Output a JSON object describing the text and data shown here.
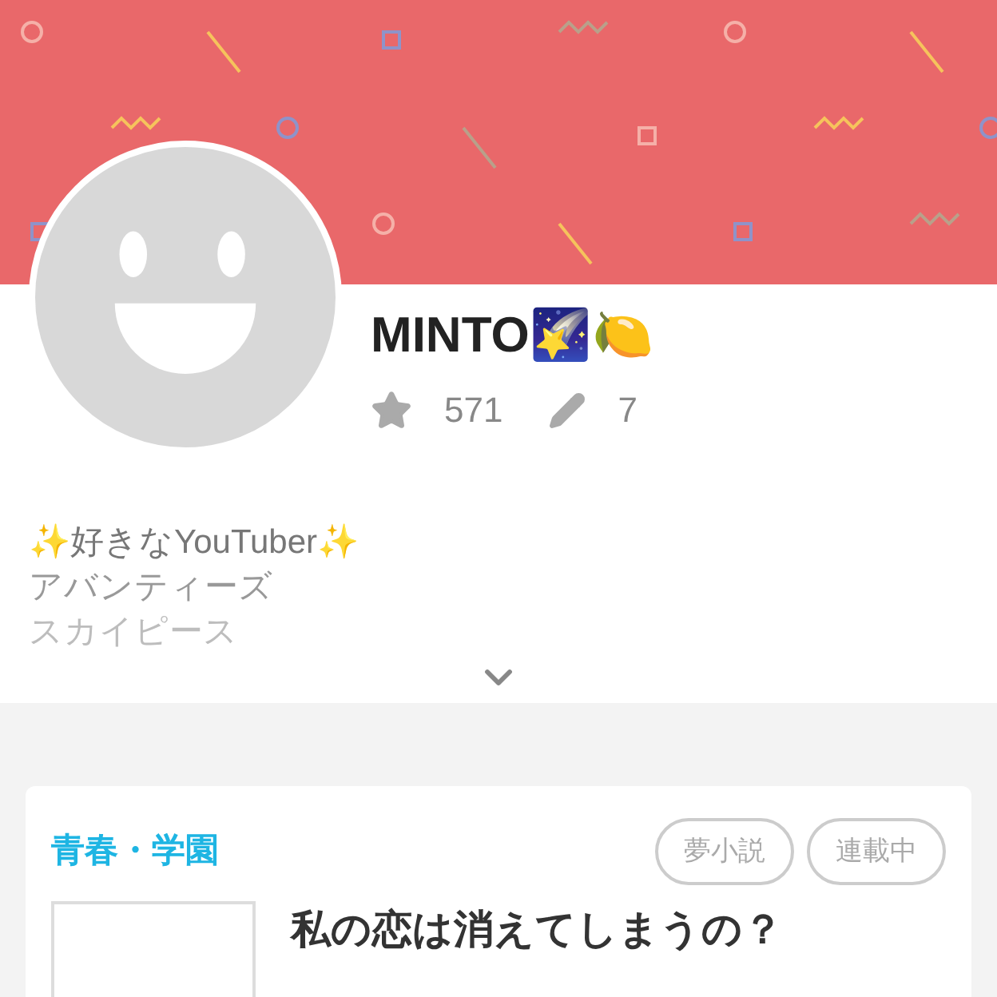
{
  "profile": {
    "name": "MINTO🌠🍋",
    "stars": "571",
    "works": "7"
  },
  "bio": {
    "lines": [
      "✨好きなYouTuber✨",
      "アバンティーズ",
      "スカイピース"
    ],
    "expanded": false
  },
  "novel": {
    "genre": "青春・学園",
    "tags": [
      "夢小説",
      "連載中"
    ],
    "title": "私の恋は消えてしまうの？"
  }
}
